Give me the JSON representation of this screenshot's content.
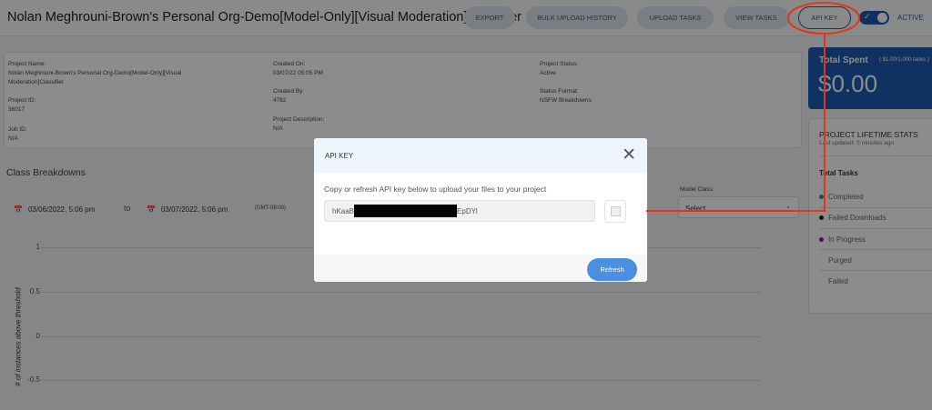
{
  "header": {
    "title": "Nolan Meghrouni-Brown's Personal Org-Demo[Model-Only][Visual Moderation]Classifier",
    "buttons": [
      "EXPORT",
      "BULK UPLOAD HISTORY",
      "UPLOAD TASKS",
      "VIEW TASKS",
      "API KEY"
    ],
    "status_label": "ACTIVE"
  },
  "info": {
    "project_name_label": "Project Name:",
    "project_name": "Nolan Meghrouni-Brown's Personal Org-Demo[Model-Only][Visual",
    "project_name_2": "Moderation]Classifier",
    "project_id_label": "Project ID:",
    "project_id": "36017",
    "job_id_label": "Job ID:",
    "job_id": "N/A",
    "created_on_label": "Created On:",
    "created_on": "03/07/22 05:05 PM",
    "created_by_label": "Created By:",
    "created_by": "4762",
    "description_label": "Project Description:",
    "description": "N/A",
    "status_label": "Project Status:",
    "status": "Active",
    "format_label": "Status Format:",
    "format": "NSFW Breakdowns"
  },
  "breakdowns": {
    "title": "Class Breakdowns",
    "from": "03/06/2022, 5:06 pm",
    "to_label": "to",
    "to": "03/07/2022, 5:06 pm",
    "tz": "(GMT-08:00)",
    "model_class_label": "Model Class:",
    "model_class_value": "Select",
    "y_axis_label": "# of instances above threshold",
    "y_ticks": [
      "1",
      "0.5",
      "0",
      "-0.5"
    ]
  },
  "spent": {
    "title": "Total Spent",
    "rate": "( $1.00/1,000 tasks )",
    "amount": "$0.00"
  },
  "stats": {
    "title": "PROJECT LIFETIME STATS",
    "updated": "Last updated: 5 minutes ago",
    "total_label": "Total Tasks",
    "items": [
      {
        "label": "Completed",
        "color": "#2e9e4f"
      },
      {
        "label": "Failed Downloads",
        "color": "#222222"
      },
      {
        "label": "In Progress",
        "color": "#8a1fa8"
      },
      {
        "label": "Purged",
        "color": ""
      },
      {
        "label": "Failed",
        "color": ""
      }
    ]
  },
  "modal": {
    "title": "API KEY",
    "description": "Copy or refresh API key below to upload your files to your project",
    "key_prefix": "hKaaB",
    "key_suffix": "EpDYl",
    "refresh_label": "Refresh"
  }
}
